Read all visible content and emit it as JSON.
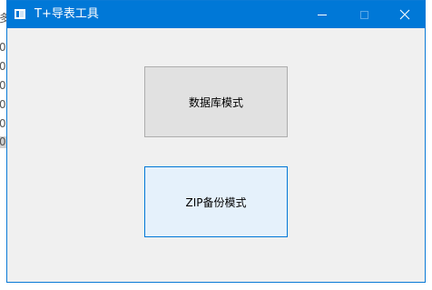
{
  "background_window": {
    "fragments": [
      "多",
      "0",
      "0",
      "0",
      "0",
      "0",
      "0"
    ]
  },
  "window": {
    "title": "T+导表工具",
    "icon": "app-window-icon",
    "titlebar_color": "#0078d7",
    "controls": {
      "minimize_icon": "minimize-icon",
      "maximize_icon": "maximize-icon",
      "close_icon": "close-icon",
      "close_glyph": "✕"
    }
  },
  "main": {
    "database_mode_label": "数据库模式",
    "zip_backup_mode_label": "ZIP备份模式"
  },
  "colors": {
    "accent": "#0078d7",
    "button_face": "#e1e1e1",
    "button_hover": "#e5f1fb",
    "client_bg": "#f0f0f0"
  }
}
